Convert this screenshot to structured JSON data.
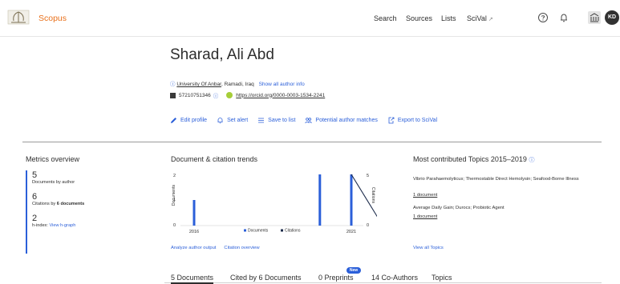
{
  "header": {
    "brand": "Scopus",
    "nav": [
      "Search",
      "Sources",
      "Lists",
      "SciVal"
    ],
    "scival_ext": "↗",
    "avatar_initials": "KD"
  },
  "author": {
    "name": "Sharad, Ali Abd",
    "affiliation_link": "University Of Anbar",
    "affiliation_location": ", Ramadi, Iraq",
    "show_all": "Show all author info",
    "author_id": "57210751346",
    "orcid_url": "https://orcid.org/0000-0003-1534-2241"
  },
  "actions": [
    "Edit profile",
    "Set alert",
    "Save to list",
    "Potential author matches",
    "Export to SciVal"
  ],
  "metrics": {
    "title": "Metrics overview",
    "documents_value": "5",
    "documents_label": "Documents by author",
    "citations_value": "6",
    "citations_label_prefix": "Citations by ",
    "citations_label_bold": "6 documents",
    "hindex_value": "2",
    "hindex_label": "h-index:",
    "hindex_link": "View h-graph"
  },
  "trends": {
    "title": "Document & citation trends",
    "analyze_link": "Analyze author output",
    "citation_link": "Citation overview"
  },
  "chart_data": {
    "type": "bar",
    "x_start": "2016",
    "x_end": "2021",
    "left_axis_label": "Documents",
    "right_axis_label": "Citations",
    "left_ticks": [
      "2",
      "1",
      "0"
    ],
    "right_ticks": [
      "5",
      "0"
    ],
    "series": [
      {
        "name": "Documents",
        "kind": "bar",
        "x": [
          2016,
          2020,
          2021
        ],
        "values": [
          1,
          2,
          2
        ],
        "color": "#2b5fd9"
      },
      {
        "name": "Citations",
        "kind": "line",
        "x": [
          2021,
          2022
        ],
        "values": [
          5,
          0
        ],
        "color": "#1b2a4a"
      }
    ]
  },
  "topics": {
    "title": "Most contributed Topics 2015–2019",
    "items": [
      {
        "name": "Vibrio Parahaemolyticus; Thermostable Direct Hemolysin; Seafood-Borne Illness",
        "docs": "1 document"
      },
      {
        "name": "Average Daily Gain; Durocs; Probiotic Agent",
        "docs": "1 document"
      }
    ],
    "view_all": "View all Topics"
  },
  "tabs": [
    "5 Documents",
    "Cited by 6 Documents",
    "0 Preprints",
    "14 Co-Authors",
    "Topics"
  ],
  "new_badge": "New",
  "colors": {
    "accent": "#2b5fd9",
    "brand": "#e9711c",
    "orcid": "#a6ce39",
    "citation_line": "#1b2a4a"
  }
}
